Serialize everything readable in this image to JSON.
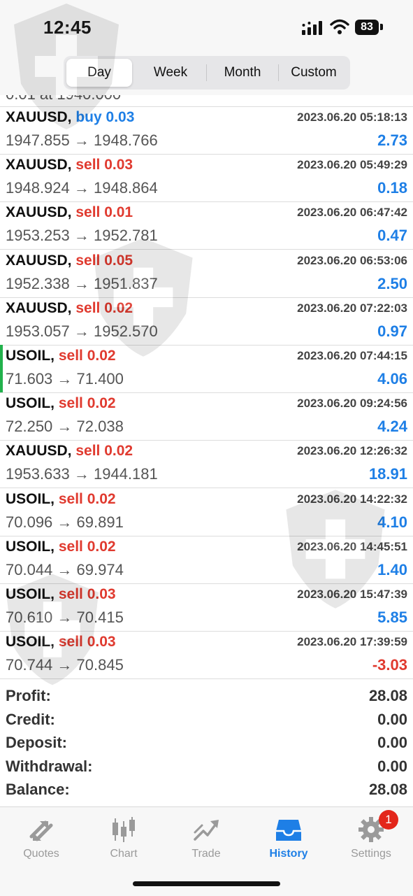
{
  "status": {
    "time": "12:45",
    "battery": "83"
  },
  "segments": [
    {
      "label": "Day",
      "active": true
    },
    {
      "label": "Week",
      "active": false
    },
    {
      "label": "Month",
      "active": false
    },
    {
      "label": "Custom",
      "active": false
    }
  ],
  "partial_row_text": "0.01 at 1940.000",
  "trades": [
    {
      "symbol": "XAUUSD,",
      "side": "buy 0.03",
      "type": "buy",
      "datetime": "2023.06.20 05:18:13",
      "prices": "1947.855 → 1948.766",
      "profit": "2.73"
    },
    {
      "symbol": "XAUUSD,",
      "side": "sell 0.03",
      "type": "sell",
      "datetime": "2023.06.20 05:49:29",
      "prices": "1948.924 → 1948.864",
      "profit": "0.18"
    },
    {
      "symbol": "XAUUSD,",
      "side": "sell 0.01",
      "type": "sell",
      "datetime": "2023.06.20 06:47:42",
      "prices": "1953.253 → 1952.781",
      "profit": "0.47"
    },
    {
      "symbol": "XAUUSD,",
      "side": "sell 0.05",
      "type": "sell",
      "datetime": "2023.06.20 06:53:06",
      "prices": "1952.338 → 1951.837",
      "profit": "2.50"
    },
    {
      "symbol": "XAUUSD,",
      "side": "sell 0.02",
      "type": "sell",
      "datetime": "2023.06.20 07:22:03",
      "prices": "1953.057 → 1952.570",
      "profit": "0.97"
    },
    {
      "symbol": "USOIL,",
      "side": "sell 0.02",
      "type": "sell",
      "datetime": "2023.06.20 07:44:15",
      "prices": "71.603 → 71.400",
      "profit": "4.06",
      "marked": true
    },
    {
      "symbol": "USOIL,",
      "side": "sell 0.02",
      "type": "sell",
      "datetime": "2023.06.20 09:24:56",
      "prices": "72.250 → 72.038",
      "profit": "4.24"
    },
    {
      "symbol": "XAUUSD,",
      "side": "sell 0.02",
      "type": "sell",
      "datetime": "2023.06.20 12:26:32",
      "prices": "1953.633 → 1944.181",
      "profit": "18.91"
    },
    {
      "symbol": "USOIL,",
      "side": "sell 0.02",
      "type": "sell",
      "datetime": "2023.06.20 14:22:32",
      "prices": "70.096 → 69.891",
      "profit": "4.10"
    },
    {
      "symbol": "USOIL,",
      "side": "sell 0.02",
      "type": "sell",
      "datetime": "2023.06.20 14:45:51",
      "prices": "70.044 → 69.974",
      "profit": "1.40"
    },
    {
      "symbol": "USOIL,",
      "side": "sell 0.03",
      "type": "sell",
      "datetime": "2023.06.20 15:47:39",
      "prices": "70.610 → 70.415",
      "profit": "5.85"
    },
    {
      "symbol": "USOIL,",
      "side": "sell 0.03",
      "type": "sell",
      "datetime": "2023.06.20 17:39:59",
      "prices": "70.744 → 70.845",
      "profit": "-3.03"
    }
  ],
  "summary": [
    {
      "label": "Profit:",
      "value": "28.08"
    },
    {
      "label": "Credit:",
      "value": "0.00"
    },
    {
      "label": "Deposit:",
      "value": "0.00"
    },
    {
      "label": "Withdrawal:",
      "value": "0.00"
    },
    {
      "label": "Balance:",
      "value": "28.08"
    }
  ],
  "tabs": [
    {
      "label": "Quotes",
      "icon": "quotes-icon",
      "active": false
    },
    {
      "label": "Chart",
      "icon": "chart-icon",
      "active": false
    },
    {
      "label": "Trade",
      "icon": "trade-icon",
      "active": false
    },
    {
      "label": "History",
      "icon": "history-icon",
      "active": true
    },
    {
      "label": "Settings",
      "icon": "settings-icon",
      "active": false
    }
  ],
  "settings_badge": "1",
  "colors": {
    "accent": "#1e7fe6",
    "sell": "#e03a2f",
    "marker": "#22b14c"
  }
}
